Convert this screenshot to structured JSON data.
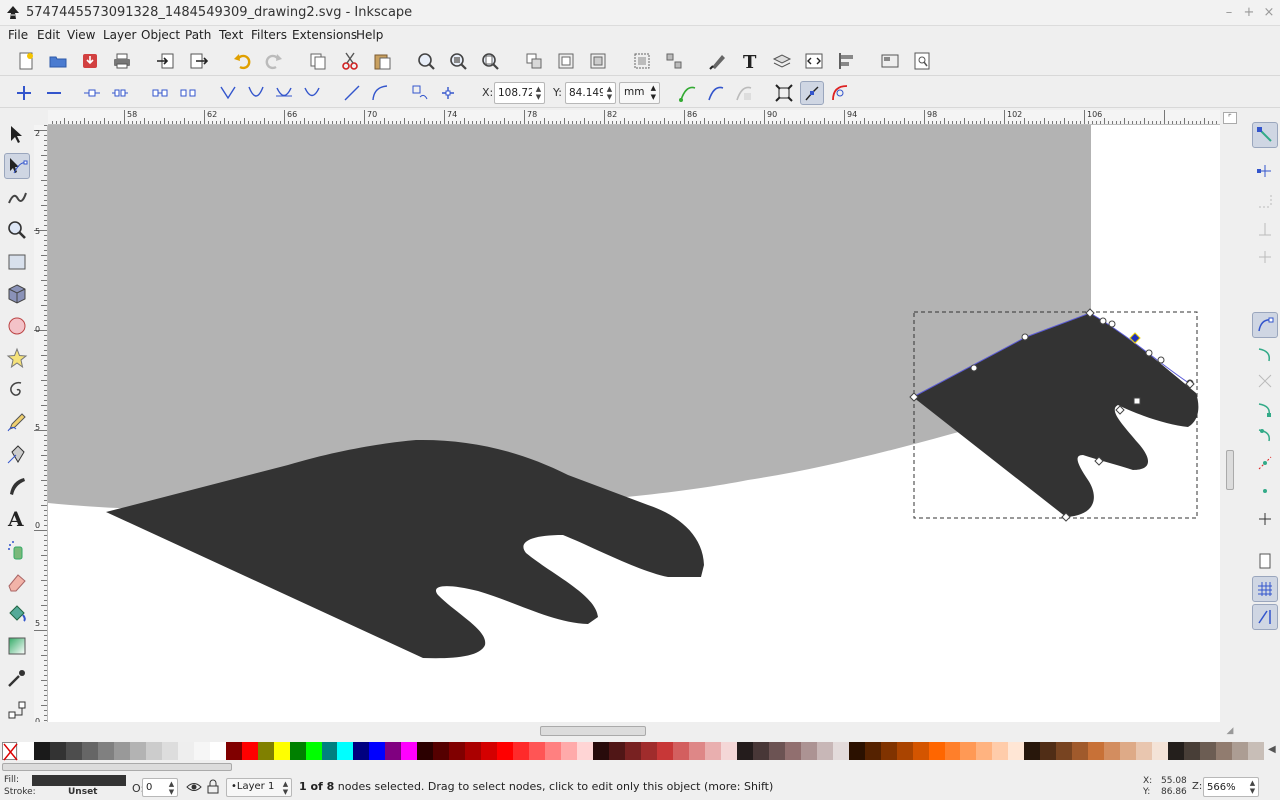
{
  "window": {
    "title": "5747445573091328_1484549309_drawing2.svg - Inkscape",
    "controls": [
      "–",
      "+",
      "×"
    ]
  },
  "menu": [
    "File",
    "Edit",
    "View",
    "Layer",
    "Object",
    "Path",
    "Text",
    "Filters",
    "Extensions",
    "Help"
  ],
  "node_controls": {
    "x_label": "X:",
    "x_value": "108.723",
    "y_label": "Y:",
    "y_value": "84.149",
    "unit": "mm"
  },
  "ruler_top_labels": [
    "58",
    "62",
    "66",
    "70",
    "74",
    "78",
    "82",
    "86",
    "90",
    "94",
    "98",
    "102",
    "106"
  ],
  "ruler_left_labels": [
    "2",
    "5",
    "0",
    "5",
    "0",
    "5",
    "0"
  ],
  "palette": [
    "#ffffff",
    "#1a1a1a",
    "#333333",
    "#4d4d4d",
    "#666666",
    "#808080",
    "#999999",
    "#b3b3b3",
    "#cccccc",
    "#dddddd",
    "#eeeeee",
    "#f6f6f6",
    "#ffffff",
    "#800000",
    "#ff0000",
    "#808000",
    "#ffff00",
    "#008000",
    "#00ff00",
    "#008080",
    "#00ffff",
    "#000080",
    "#0000ff",
    "#800080",
    "#ff00ff",
    "#2b0000",
    "#550000",
    "#800000",
    "#aa0000",
    "#d40000",
    "#ff0000",
    "#ff2a2a",
    "#ff5555",
    "#ff8080",
    "#ffaaaa",
    "#ffd5d5",
    "#280b0b",
    "#501616",
    "#782121",
    "#a02c2c",
    "#c83737",
    "#d35f5f",
    "#de8787",
    "#e9afaf",
    "#f4d7d7",
    "#241c1c",
    "#483737",
    "#6c5353",
    "#916f6f",
    "#ac9393",
    "#c8b7b7",
    "#e3dbdb",
    "#2b1100",
    "#552200",
    "#803300",
    "#aa4400",
    "#d45500",
    "#ff6600",
    "#ff7f2a",
    "#ff9955",
    "#ffb380",
    "#ffccaa",
    "#ffe6d5",
    "#28170b",
    "#502d16",
    "#784421",
    "#a05a2c",
    "#c87137",
    "#d38d5f",
    "#deaa87",
    "#e9c6af",
    "#f4e3d7",
    "#241f1c",
    "#483e37",
    "#6c5d53",
    "#917c6f",
    "#ac9d93",
    "#c8beb7"
  ],
  "status": {
    "fill_label": "Fill:",
    "stroke_label": "Stroke:",
    "stroke_value": "Unset",
    "fill_color": "#333333",
    "opacity_label": "O:",
    "opacity_value": "0",
    "layer": "•Layer 1",
    "message_bold": "1 of 8",
    "message": " nodes selected. Drag to select nodes, click to edit only this object (more: Shift)",
    "x_label": "X:",
    "x_value": "55.08",
    "y_label": "Y:",
    "y_value": "86.86",
    "zoom_label": "Z:",
    "zoom_value": "566%"
  },
  "colors": {
    "canvas_gray": "#b3b3b3",
    "shape_dark": "#333333",
    "selection_path": "#5a5ad6",
    "accent": "#3355cc"
  },
  "icons": {
    "toolbox": [
      "selector-tool-icon",
      "node-tool-icon",
      "tweak-tool-icon",
      "zoom-tool-icon",
      "rect-tool-icon",
      "3dbox-tool-icon",
      "ellipse-tool-icon",
      "star-tool-icon",
      "spiral-tool-icon",
      "pencil-tool-icon",
      "pen-tool-icon",
      "calligraphy-tool-icon",
      "text-tool-icon",
      "spray-tool-icon",
      "eraser-tool-icon",
      "paint-bucket-tool-icon",
      "gradient-tool-icon",
      "dropper-tool-icon",
      "connector-tool-icon"
    ]
  }
}
